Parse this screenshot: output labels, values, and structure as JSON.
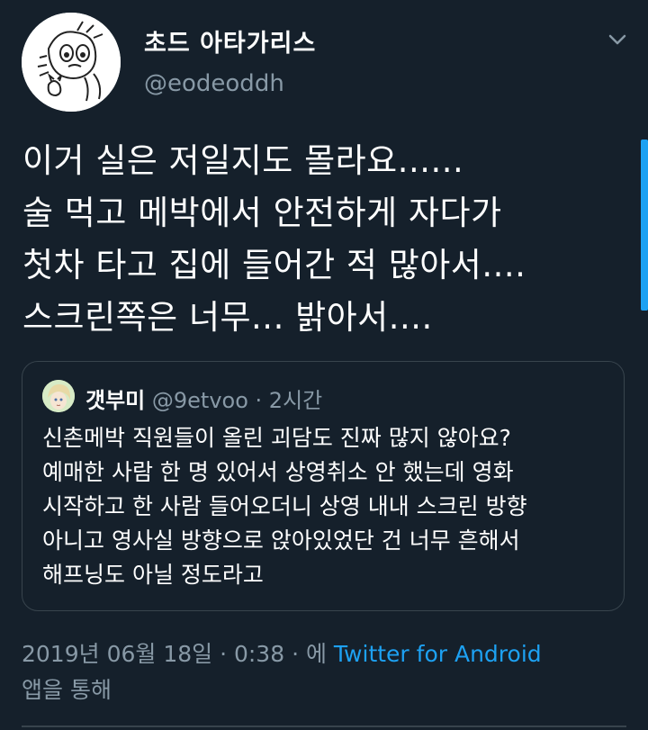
{
  "author": {
    "display_name": "초드 아타가리스",
    "handle": "@eodeoddh",
    "avatar_icon": "sketch-avatar-icon"
  },
  "tweet": {
    "text": "이거 실은 저일지도 몰라요......\n술 먹고 메박에서 안전하게 자다가\n첫차 타고 집에 들어간 적 많아서....\n스크린쪽은 너무... 밝아서...."
  },
  "quoted_tweet": {
    "display_name": "갯부미",
    "handle": "@9etvoo",
    "separator": " · ",
    "time": "2시간",
    "text": "신촌메박 직원들이 올린 괴담도 진짜 많지 않아요?\n예매한 사람 한 명 있어서 상영취소 안 했는데 영화\n시작하고 한 사람 들어오더니 상영 내내 스크린 방향\n아니고 영사실 방향으로 앉아있었단 건 너무 흔해서\n해프닝도 아닐 정도라고"
  },
  "footer": {
    "timestamp": "2019년 06월 18일 · 0:38 · 에 ",
    "source": "Twitter for Android",
    "suffix": "앱을 통해"
  },
  "colors": {
    "background": "#15202b",
    "text_primary": "#ffffff",
    "text_secondary": "#8899a6",
    "accent": "#1da1f2",
    "border": "#38444d"
  }
}
